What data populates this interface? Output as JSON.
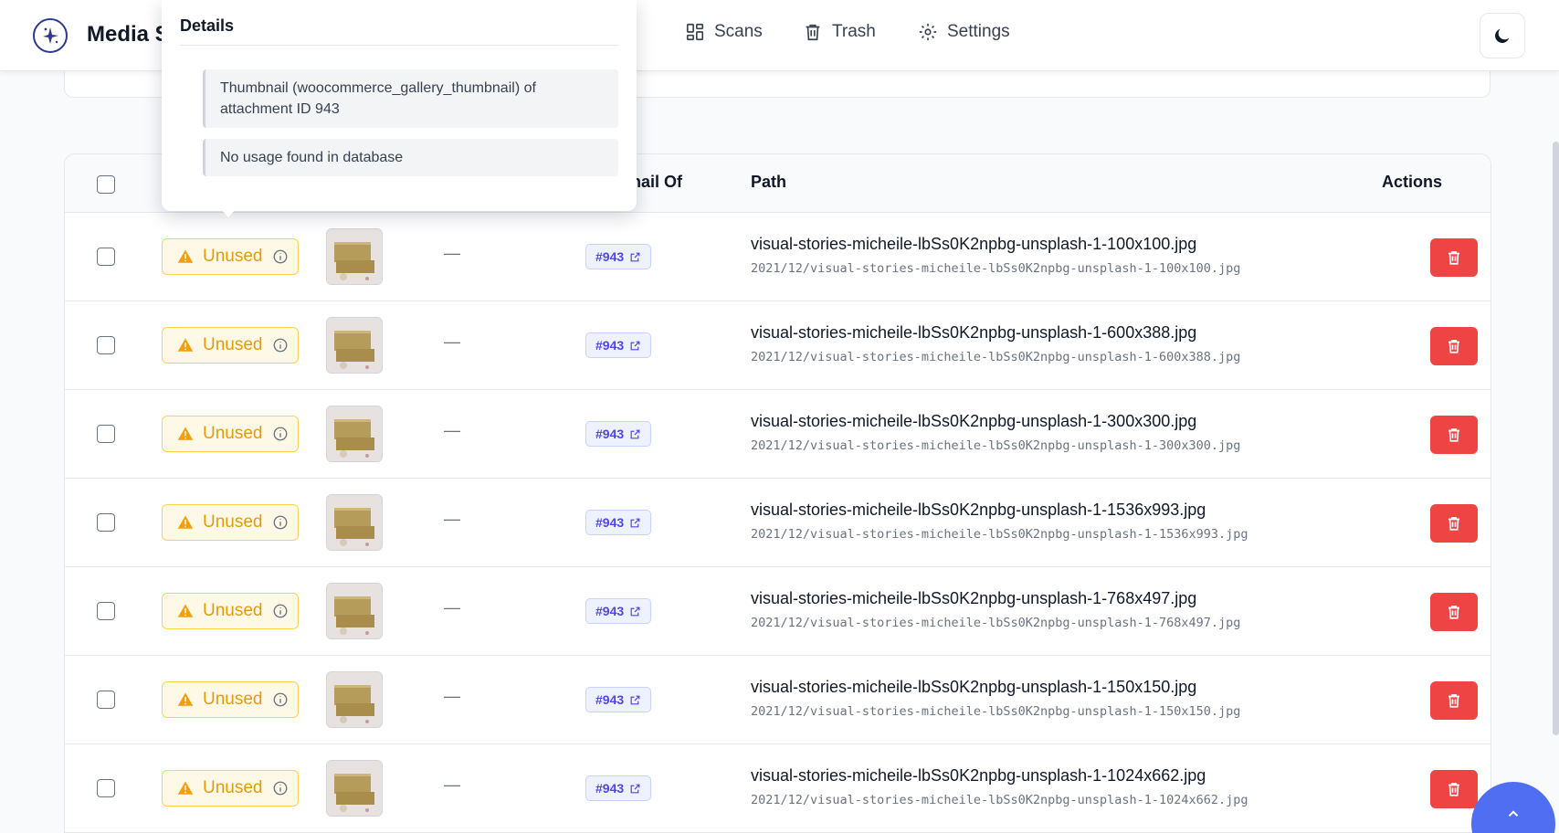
{
  "app": {
    "title": "Media S"
  },
  "nav": {
    "scans": "Scans",
    "trash": "Trash",
    "settings": "Settings"
  },
  "popover": {
    "title": "Details",
    "items": [
      "Thumbnail (woocommerce_gallery_thumbnail) of attachment ID 943",
      "No usage found in database"
    ]
  },
  "table": {
    "headers": {
      "thumbnail_of": "nail Of",
      "path": "Path",
      "actions": "Actions"
    },
    "rows": [
      {
        "status": "Unused",
        "dash": "—",
        "id": "#943",
        "name": "visual-stories-micheile-lbSs0K2npbg-unsplash-1-100x100.jpg",
        "path": "2021/12/visual-stories-micheile-lbSs0K2npbg-unsplash-1-100x100.jpg"
      },
      {
        "status": "Unused",
        "dash": "—",
        "id": "#943",
        "name": "visual-stories-micheile-lbSs0K2npbg-unsplash-1-600x388.jpg",
        "path": "2021/12/visual-stories-micheile-lbSs0K2npbg-unsplash-1-600x388.jpg"
      },
      {
        "status": "Unused",
        "dash": "—",
        "id": "#943",
        "name": "visual-stories-micheile-lbSs0K2npbg-unsplash-1-300x300.jpg",
        "path": "2021/12/visual-stories-micheile-lbSs0K2npbg-unsplash-1-300x300.jpg"
      },
      {
        "status": "Unused",
        "dash": "—",
        "id": "#943",
        "name": "visual-stories-micheile-lbSs0K2npbg-unsplash-1-1536x993.jpg",
        "path": "2021/12/visual-stories-micheile-lbSs0K2npbg-unsplash-1-1536x993.jpg"
      },
      {
        "status": "Unused",
        "dash": "—",
        "id": "#943",
        "name": "visual-stories-micheile-lbSs0K2npbg-unsplash-1-768x497.jpg",
        "path": "2021/12/visual-stories-micheile-lbSs0K2npbg-unsplash-1-768x497.jpg"
      },
      {
        "status": "Unused",
        "dash": "—",
        "id": "#943",
        "name": "visual-stories-micheile-lbSs0K2npbg-unsplash-1-150x150.jpg",
        "path": "2021/12/visual-stories-micheile-lbSs0K2npbg-unsplash-1-150x150.jpg"
      },
      {
        "status": "Unused",
        "dash": "—",
        "id": "#943",
        "name": "visual-stories-micheile-lbSs0K2npbg-unsplash-1-1024x662.jpg",
        "path": "2021/12/visual-stories-micheile-lbSs0K2npbg-unsplash-1-1024x662.jpg"
      }
    ]
  },
  "colors": {
    "accent": "#4f46e5",
    "danger": "#ef4444",
    "warning": "#e29b0c",
    "fab": "#4f6ef2"
  }
}
